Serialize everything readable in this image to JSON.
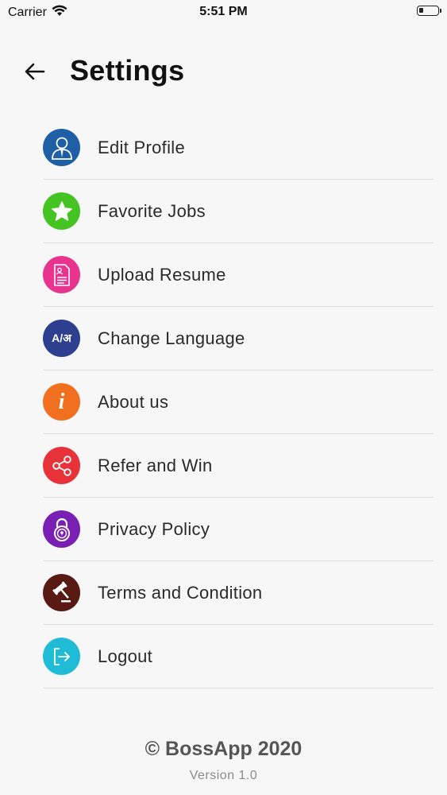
{
  "status_bar": {
    "carrier": "Carrier",
    "time": "5:51 PM"
  },
  "header": {
    "title": "Settings"
  },
  "menu": {
    "items": [
      {
        "label": "Edit Profile",
        "icon": "user-profile-icon",
        "color": "#1f5fa6"
      },
      {
        "label": "Favorite Jobs",
        "icon": "star-icon",
        "color": "#44c322"
      },
      {
        "label": "Upload Resume",
        "icon": "resume-document-icon",
        "color": "#e8338f"
      },
      {
        "label": "Change Language",
        "icon": "language-icon",
        "icon_text": "A/अ",
        "color": "#2e3f8f"
      },
      {
        "label": "About us",
        "icon": "info-icon",
        "icon_text": "i",
        "color": "#f07020"
      },
      {
        "label": "Refer and Win",
        "icon": "share-icon",
        "color": "#e8323a"
      },
      {
        "label": "Privacy Policy",
        "icon": "padlock-icon",
        "color": "#7a1fb3"
      },
      {
        "label": "Terms and Condition",
        "icon": "gavel-icon",
        "color": "#5a1a14"
      },
      {
        "label": "Logout",
        "icon": "logout-icon",
        "color": "#20bcd6"
      }
    ]
  },
  "footer": {
    "copyright": "© BossApp 2020",
    "version": "Version 1.0"
  }
}
